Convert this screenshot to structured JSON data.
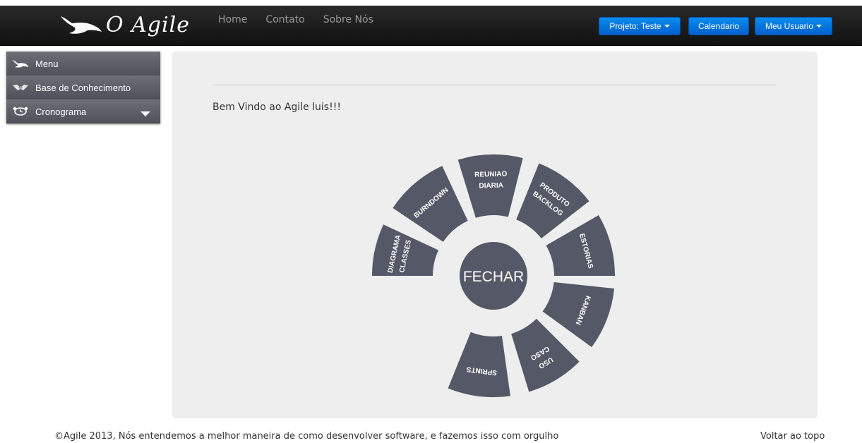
{
  "brand": {
    "title": "O Agile",
    "logo_icon": "bird-icon"
  },
  "nav": {
    "links": [
      "Home",
      "Contato",
      "Sobre Nós"
    ],
    "project_button": "Projeto: Teste",
    "calendar_button": "Calendario",
    "user_button": "Meu Usuario"
  },
  "sidebar": {
    "items": [
      {
        "label": "Menu",
        "icon": "bird-icon"
      },
      {
        "label": "Base de Conhecimento",
        "icon": "handshake-icon"
      },
      {
        "label": "Cronograma",
        "icon": "clock-icon"
      }
    ]
  },
  "main": {
    "welcome": "Bem Vindo ao Agile luis!!!",
    "wheel": {
      "center_label": "FECHAR",
      "segments": [
        {
          "lines": [
            "DIAGRAMA",
            "CLASSES"
          ]
        },
        {
          "lines": [
            "BURNDOWN"
          ]
        },
        {
          "lines": [
            "REUNIAO",
            "DIARIA"
          ]
        },
        {
          "lines": [
            "PRODUTO",
            "BACKLOG"
          ]
        },
        {
          "lines": [
            "ESTORIAS"
          ]
        },
        {
          "lines": [
            "KANBAN"
          ]
        },
        {
          "lines": [
            "USO",
            "CASO"
          ]
        },
        {
          "lines": [
            "SPRINTS"
          ]
        }
      ],
      "color": "#555866"
    }
  },
  "footer": {
    "copyright": "©Agile 2013, Nós entendemos a melhor maneira de como desenvolver software, e fazemos isso com orgulho",
    "back_to_top": "Voltar ao topo"
  }
}
